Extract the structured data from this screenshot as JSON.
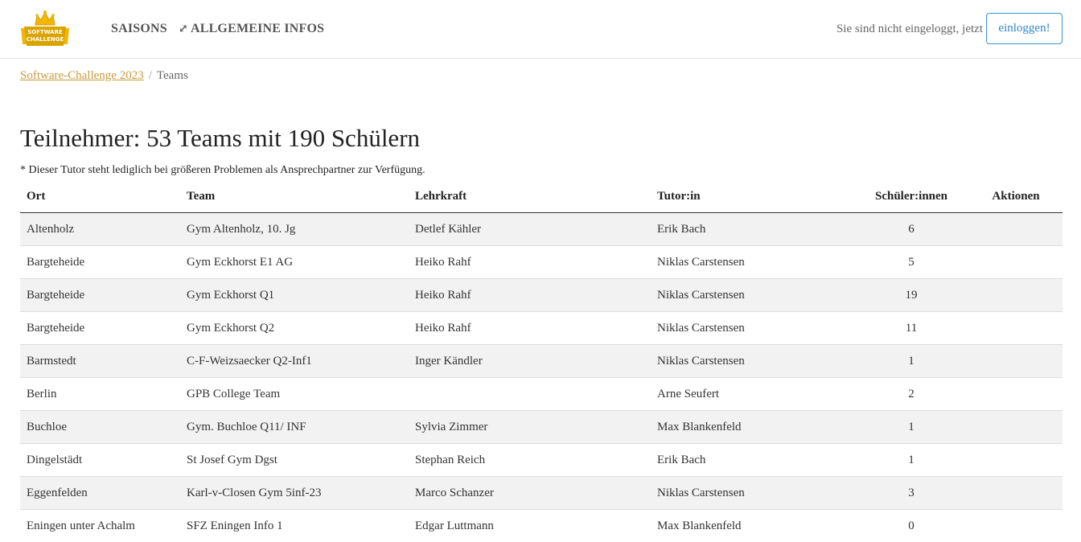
{
  "navbar": {
    "logo_text": "SOFTWARE CHALLENGE",
    "nav_saisons": "SAISONS",
    "nav_infos_icon": "external-link-icon",
    "nav_infos": "ALLGEMEINE INFOS",
    "login_text": "Sie sind nicht eingeloggt, jetzt",
    "login_button": "einloggen!"
  },
  "breadcrumb": {
    "parent": "Software-Challenge 2023",
    "separator": "/",
    "current": "Teams"
  },
  "page": {
    "title": "Teilnehmer: 53 Teams mit 190 Schülern",
    "note": "* Dieser Tutor steht lediglich bei größeren Problemen als Ansprechpartner zur Verfügung."
  },
  "table": {
    "headers": {
      "ort": "Ort",
      "team": "Team",
      "lehrkraft": "Lehrkraft",
      "tutor": "Tutor:in",
      "schueler": "Schüler:innen",
      "aktionen": "Aktionen"
    },
    "rows": [
      {
        "ort": "Altenholz",
        "team": "Gym Altenholz, 10. Jg",
        "lehrkraft": "Detlef Kähler",
        "tutor": "Erik Bach",
        "schueler": "6"
      },
      {
        "ort": "Bargteheide",
        "team": "Gym Eckhorst E1 AG",
        "lehrkraft": "Heiko Rahf",
        "tutor": "Niklas Carstensen",
        "schueler": "5"
      },
      {
        "ort": "Bargteheide",
        "team": "Gym Eckhorst Q1",
        "lehrkraft": "Heiko Rahf",
        "tutor": "Niklas Carstensen",
        "schueler": "19"
      },
      {
        "ort": "Bargteheide",
        "team": "Gym Eckhorst Q2",
        "lehrkraft": "Heiko Rahf",
        "tutor": "Niklas Carstensen",
        "schueler": "11"
      },
      {
        "ort": "Barmstedt",
        "team": "C-F-Weizsaecker Q2-Inf1",
        "lehrkraft": "Inger Kändler",
        "tutor": "Niklas Carstensen",
        "schueler": "1"
      },
      {
        "ort": "Berlin",
        "team": "GPB College Team",
        "lehrkraft": "",
        "tutor": "Arne Seufert",
        "schueler": "2"
      },
      {
        "ort": "Buchloe",
        "team": "Gym. Buchloe Q11/ INF",
        "lehrkraft": "Sylvia Zimmer",
        "tutor": "Max Blankenfeld",
        "schueler": "1"
      },
      {
        "ort": "Dingelstädt",
        "team": "St Josef Gym Dgst",
        "lehrkraft": "Stephan Reich",
        "tutor": "Erik Bach",
        "schueler": "1"
      },
      {
        "ort": "Eggenfelden",
        "team": "Karl-v-Closen Gym 5inf-23",
        "lehrkraft": "Marco Schanzer",
        "tutor": "Niklas Carstensen",
        "schueler": "3"
      },
      {
        "ort": "Eningen unter Achalm",
        "team": "SFZ Eningen Info 1",
        "lehrkraft": "Edgar Luttmann",
        "tutor": "Max Blankenfeld",
        "schueler": "0"
      }
    ]
  },
  "colors": {
    "brand_gold": "#c89b3c",
    "login_blue": "#2f86c6",
    "stripe": "#f2f2f2"
  }
}
